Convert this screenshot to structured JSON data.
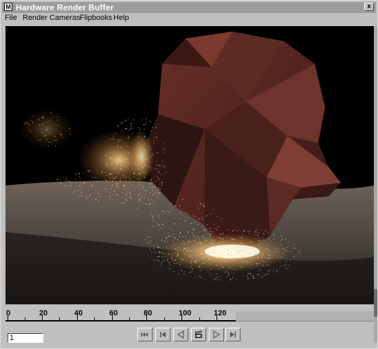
{
  "window": {
    "title": "Hardware Render Buffer",
    "close_glyph": "x",
    "icon_glyph": "M"
  },
  "menu": {
    "items": [
      "File",
      "Render",
      "Cameras",
      "Flipbooks",
      "Help"
    ]
  },
  "viewport": {
    "content": "render-image-rock-dust-particles"
  },
  "timeline": {
    "ticks": [
      "0",
      "20",
      "40",
      "60",
      "80",
      "100",
      "120"
    ],
    "current_frame": "1"
  },
  "playback": {
    "buttons": [
      "go-to-start-icon",
      "step-back-icon",
      "play-backward-icon",
      "render-sequence-icon",
      "play-forward-icon",
      "step-forward-icon"
    ]
  },
  "colors": {
    "title_bar": "#9c9c9c",
    "window_bg": "#c0c0c0",
    "viewport_bg": "#000000"
  }
}
